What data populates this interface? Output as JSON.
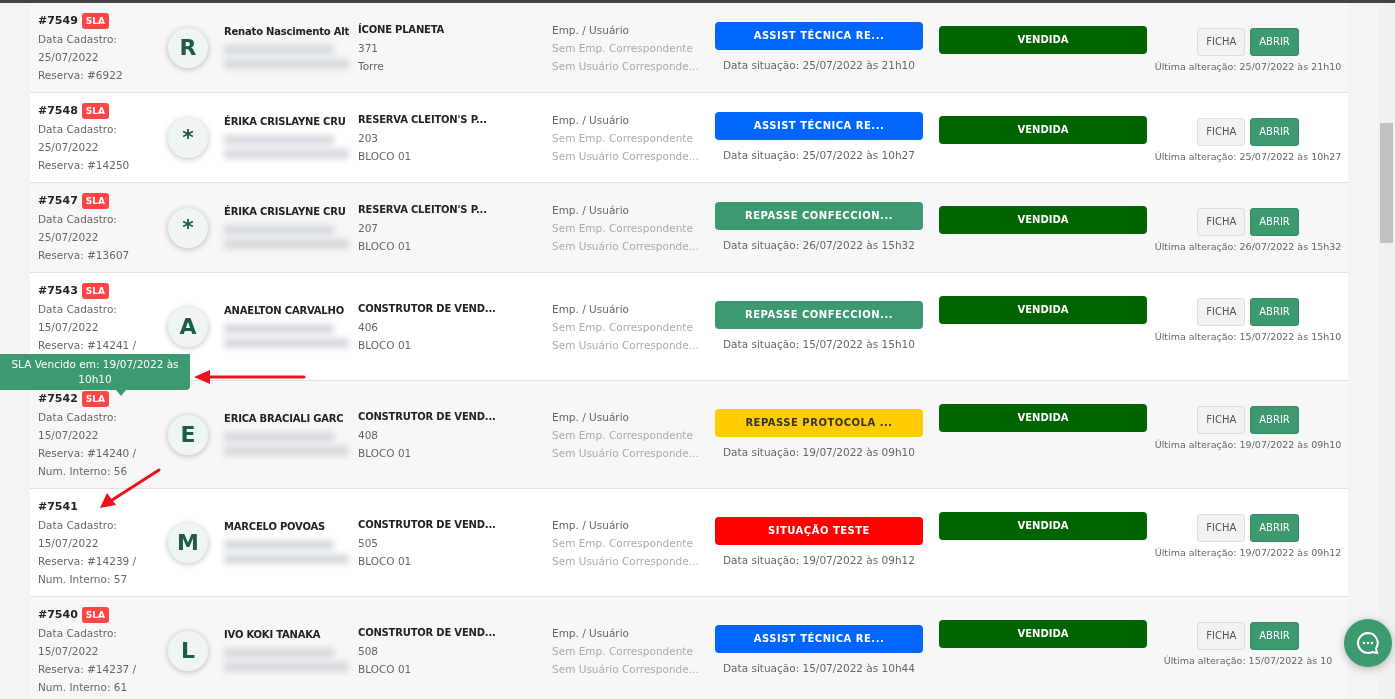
{
  "rows": [
    {
      "id": "#7549",
      "sla_label": "SLA",
      "cadastro_label": "Data Cadastro:",
      "cadastro_date": "25/07/2022",
      "reserva": "Reserva: #6922",
      "avatar_letter": "R",
      "client": "Renato Nascimento Alt",
      "contact_redacted": true,
      "project": "ÍCONE PLANETA",
      "unit": "371",
      "block": "Torre",
      "emp_label": "Emp. / Usuário",
      "emp": "Sem Emp. Correspondente",
      "user": "Sem Usuário Corresponde...",
      "status": {
        "label": "ASSIST TÉCNICA RE...",
        "color": "#0066ff"
      },
      "status_date": "Data situação: 25/07/2022 às 21h10",
      "sale": "VENDIDA",
      "ficha": "FICHA",
      "abrir": "ABRIR",
      "last_change": "Última alteração: 25/07/2022 às 21h10"
    },
    {
      "id": "#7548",
      "sla_label": "SLA",
      "cadastro_label": "Data Cadastro:",
      "cadastro_date": "25/07/2022",
      "reserva": "Reserva: #14250",
      "avatar_letter": "*",
      "client": "ÉRIKA CRISLAYNE CRU",
      "contact_redacted": true,
      "project": "RESERVA CLEITON'S P...",
      "unit": "203",
      "block": "BLOCO 01",
      "emp_label": "Emp. / Usuário",
      "emp": "Sem Emp. Correspondente",
      "user": "Sem Usuário Corresponde...",
      "status": {
        "label": "ASSIST TÉCNICA RE...",
        "color": "#0066ff"
      },
      "status_date": "Data situação: 25/07/2022 às 10h27",
      "sale": "VENDIDA",
      "ficha": "FICHA",
      "abrir": "ABRIR",
      "last_change": "Última alteração: 25/07/2022 às 10h27"
    },
    {
      "id": "#7547",
      "sla_label": "SLA",
      "cadastro_label": "Data Cadastro:",
      "cadastro_date": "25/07/2022",
      "reserva": "Reserva: #13607",
      "avatar_letter": "*",
      "client": "ÉRIKA CRISLAYNE CRU",
      "contact_redacted": true,
      "project": "RESERVA CLEITON'S P...",
      "unit": "207",
      "block": "BLOCO 01",
      "emp_label": "Emp. / Usuário",
      "emp": "Sem Emp. Correspondente",
      "user": "Sem Usuário Corresponde...",
      "status": {
        "label": "REPASSE CONFECCION...",
        "color": "#3d9970"
      },
      "status_date": "Data situação: 26/07/2022 às 15h32",
      "sale": "VENDIDA",
      "ficha": "FICHA",
      "abrir": "ABRIR",
      "last_change": "Última alteração: 26/07/2022 às 15h32"
    },
    {
      "id": "#7543",
      "sla_label": "SLA",
      "cadastro_label": "Data Cadastro:",
      "cadastro_date": "15/07/2022",
      "reserva": "Reserva: #14241 /",
      "avatar_letter": "A",
      "client": "ANAELTON CARVALHO",
      "contact_redacted": true,
      "project": "CONSTRUTOR DE VEND...",
      "unit": "406",
      "block": "BLOCO 01",
      "emp_label": "Emp. / Usuário",
      "emp": "Sem Emp. Correspondente",
      "user": "Sem Usuário Corresponde...",
      "status": {
        "label": "REPASSE CONFECCION...",
        "color": "#3d9970"
      },
      "status_date": "Data situação: 15/07/2022 às 15h10",
      "sale": "VENDIDA",
      "ficha": "FICHA",
      "abrir": "ABRIR",
      "last_change": "Última alteração: 15/07/2022 às 15h10"
    },
    {
      "id": "#7542",
      "sla_label": "SLA",
      "cadastro_label": "Data Cadastro:",
      "cadastro_date": "15/07/2022",
      "reserva": "Reserva: #14240 /",
      "interno": "Num. Interno: 56",
      "avatar_letter": "E",
      "client": "ERICA BRACIALI GARC",
      "contact_redacted": true,
      "project": "CONSTRUTOR DE VEND...",
      "unit": "408",
      "block": "BLOCO 01",
      "emp_label": "Emp. / Usuário",
      "emp": "Sem Emp. Correspondente",
      "user": "Sem Usuário Corresponde...",
      "status": {
        "label": "REPASSE PROTOCOLA ...",
        "color": "#ffcc00"
      },
      "status_date": "Data situação: 19/07/2022 às 09h10",
      "sale": "VENDIDA",
      "ficha": "FICHA",
      "abrir": "ABRIR",
      "last_change": "Última alteração: 19/07/2022 às 09h10"
    },
    {
      "id": "#7541",
      "cadastro_label": "Data Cadastro:",
      "cadastro_date": "15/07/2022",
      "reserva": "Reserva: #14239 /",
      "interno": "Num. Interno: 57",
      "avatar_letter": "M",
      "client": "MARCELO POVOAS",
      "contact_redacted": true,
      "project": "CONSTRUTOR DE VEND...",
      "unit": "505",
      "block": "BLOCO 01",
      "emp_label": "Emp. / Usuário",
      "emp": "Sem Emp. Correspondente",
      "user": "Sem Usuário Corresponde...",
      "status": {
        "label": "SITUAÇÃO TESTE",
        "color": "#ff0000"
      },
      "status_date": "Data situação: 19/07/2022 às 09h12",
      "sale": "VENDIDA",
      "ficha": "FICHA",
      "abrir": "ABRIR",
      "last_change": "Última alteração: 19/07/2022 às 09h12"
    },
    {
      "id": "#7540",
      "sla_label": "SLA",
      "cadastro_label": "Data Cadastro:",
      "cadastro_date": "15/07/2022",
      "reserva": "Reserva: #14237 /",
      "interno": "Num. Interno: 61",
      "avatar_letter": "L",
      "client": "IVO KOKI TANAKA",
      "contact_redacted": true,
      "project": "CONSTRUTOR DE VEND...",
      "unit": "508",
      "block": "BLOCO 01",
      "emp_label": "Emp. / Usuário",
      "emp": "Sem Emp. Correspondente",
      "user": "Sem Usuário Corresponde...",
      "status": {
        "label": "ASSIST TÉCNICA RE...",
        "color": "#0066ff"
      },
      "status_date": "Data situação: 15/07/2022 às 10h44",
      "sale": "VENDIDA",
      "ficha": "FICHA",
      "abrir": "ABRIR",
      "last_change": "Última alteração: 15/07/2022 às 10"
    }
  ],
  "tooltip": {
    "text": "SLA Vencido em: 19/07/2022 às 10h10"
  }
}
